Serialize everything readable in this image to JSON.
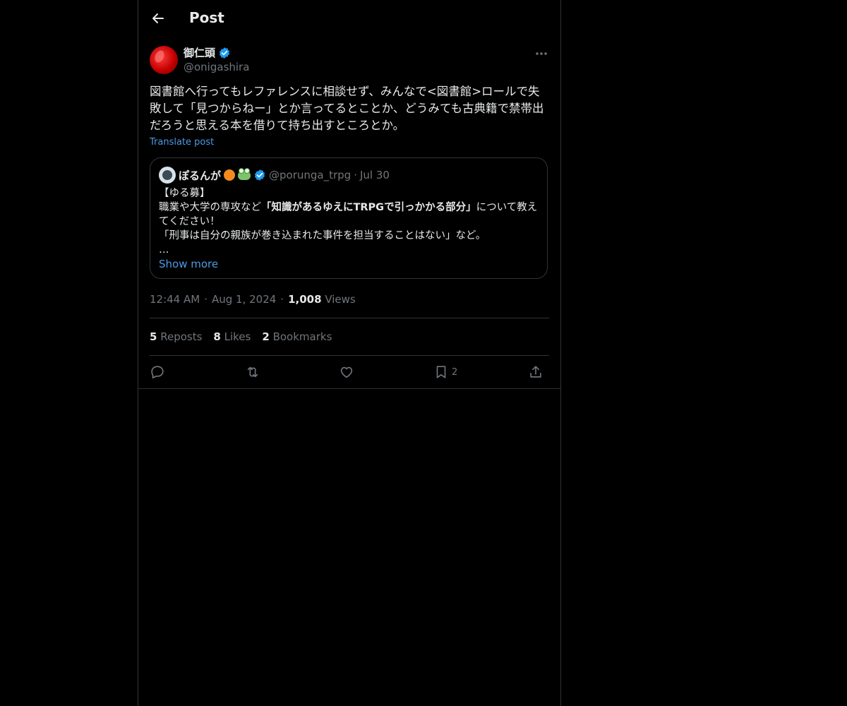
{
  "header": {
    "title": "Post",
    "back_icon": "arrow-left-icon"
  },
  "post": {
    "author": {
      "name": "御仁頭",
      "handle": "@onigashira",
      "verified": true,
      "verified_color": "#1d9bf0"
    },
    "text": "図書館へ行ってもレファレンスに相談せず、みんなで<図書館>ロールで失敗して「見つからねー」とか言ってるとことか、どうみても古典籍で禁帯出だろうと思える本を借りて持ち出すところとか。",
    "translate_label": "Translate post",
    "quote": {
      "name": "ぽるんが",
      "handle": "@porunga_trpg",
      "separator": "·",
      "date": "Jul 30",
      "line1": "【ゆる募】",
      "line2_pre": "職業や大学の専攻など",
      "line2_bold": "「知識があるゆえにTRPGで引っかかる部分」",
      "line2_post": "について教えてください！",
      "line3": "「刑事は自分の親族が巻き込まれた事件を担当することはない」など。",
      "ellipsis": "…",
      "show_more": "Show more"
    },
    "meta": {
      "time": "12:44 AM",
      "dot": "·",
      "date": "Aug 1, 2024",
      "views_count": "1,008",
      "views_label": "Views"
    },
    "stats": {
      "reposts_count": "5",
      "reposts_label": "Reposts",
      "likes_count": "8",
      "likes_label": "Likes",
      "bookmarks_count": "2",
      "bookmarks_label": "Bookmarks"
    },
    "actions": {
      "bookmark_count": "2"
    }
  },
  "colors": {
    "background": "#000000",
    "text": "#e7e9ea",
    "muted": "#71767b",
    "link": "#4c9ae6",
    "border": "#2f3336"
  }
}
